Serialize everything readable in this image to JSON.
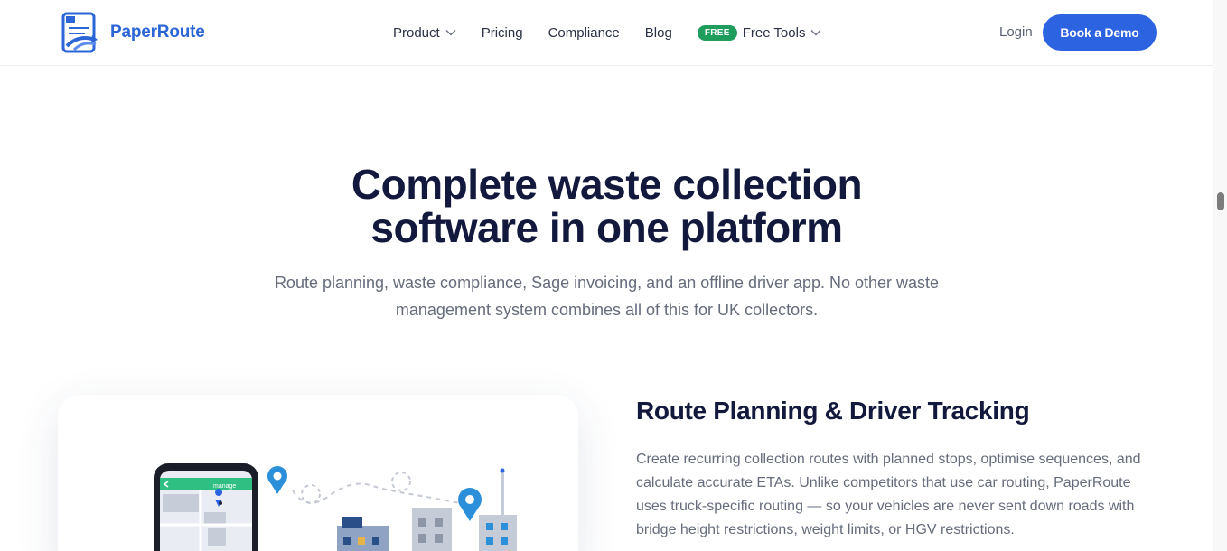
{
  "header": {
    "brand": "PaperRoute",
    "nav": [
      {
        "label": "Product",
        "dropdown": true
      },
      {
        "label": "Pricing",
        "dropdown": false
      },
      {
        "label": "Compliance",
        "dropdown": false
      },
      {
        "label": "Blog",
        "dropdown": false
      }
    ],
    "free_tools": {
      "badge": "FREE",
      "label": "Free Tools"
    },
    "login": "Login",
    "cta": "Book a Demo"
  },
  "hero": {
    "title_line1": "Complete waste collection",
    "title_line2": "software in one platform",
    "subtitle_line1": "Route planning, waste compliance, Sage invoicing, and an offline driver app. No other waste",
    "subtitle_line2": "management system combines all of this for UK collectors."
  },
  "feature": {
    "title": "Route Planning & Driver Tracking",
    "body": "Create recurring collection routes with planned stops, optimise sequences, and calculate accurate ETAs. Unlike competitors that use car routing, PaperRoute uses truck-specific routing — so your vehicles are never sent down roads with bridge height restrictions, weight limits, or HGV restrictions.",
    "phone_app_label": "manage"
  },
  "colors": {
    "brand_blue": "#2b63e0",
    "heading_navy": "#12193d",
    "free_green": "#1f9d5c",
    "muted_text": "#666c7c"
  }
}
